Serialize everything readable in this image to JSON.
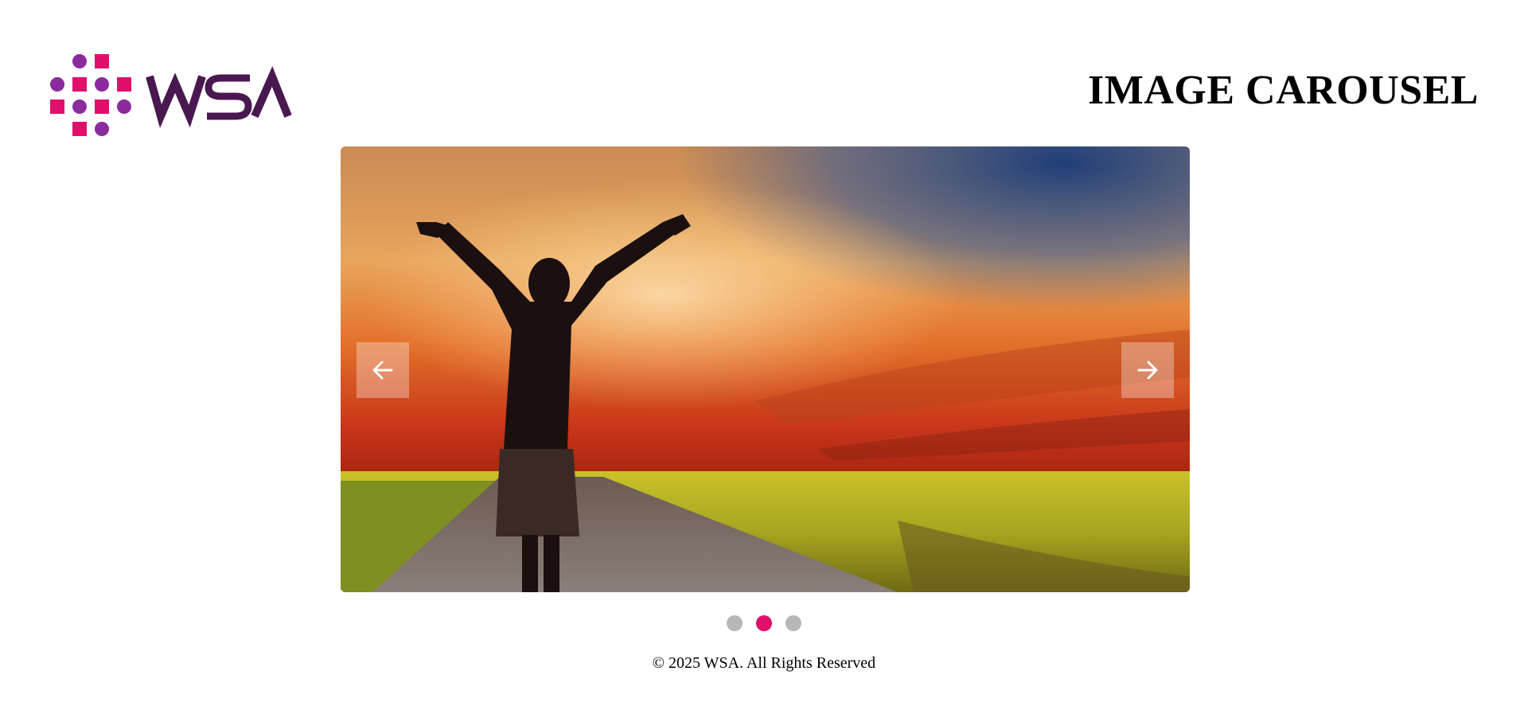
{
  "header": {
    "logo_text": "WSA",
    "title": "IMAGE CAROUSEL"
  },
  "carousel": {
    "prev_icon": "arrow-left-icon",
    "next_icon": "arrow-right-icon",
    "slide_count": 3,
    "active_index": 1
  },
  "colors": {
    "brand_pink": "#e0106a",
    "brand_purple": "#8a2b9e",
    "wordmark": "#4a1850",
    "dot_inactive": "#b7b7b7"
  },
  "footer": {
    "text": "© 2025 WSA. All Rights Reserved"
  }
}
